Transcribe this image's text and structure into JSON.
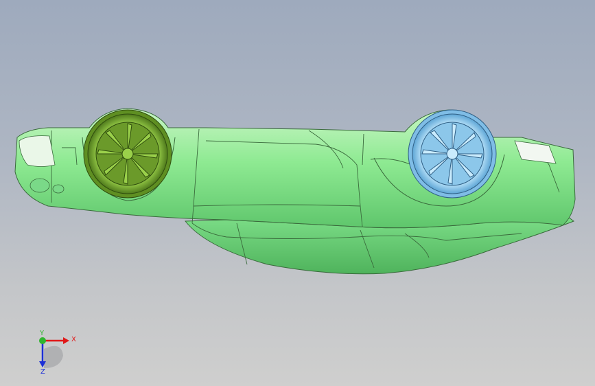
{
  "viewport": {
    "background_top": "#9eaabd",
    "background_bottom": "#cfcfce"
  },
  "model": {
    "body_color": "#86e98f",
    "body_highlight": "#c8f5c4",
    "edge_color": "#3a6a3c",
    "front_wheel_color": "#7fb23a",
    "rear_wheel_color": "#9fd3f2"
  },
  "triad": {
    "x_label": "X",
    "y_label": "Y",
    "z_label": "Z",
    "x_color": "#e01818",
    "y_color": "#2fb52f",
    "z_color": "#1c2fd6"
  }
}
